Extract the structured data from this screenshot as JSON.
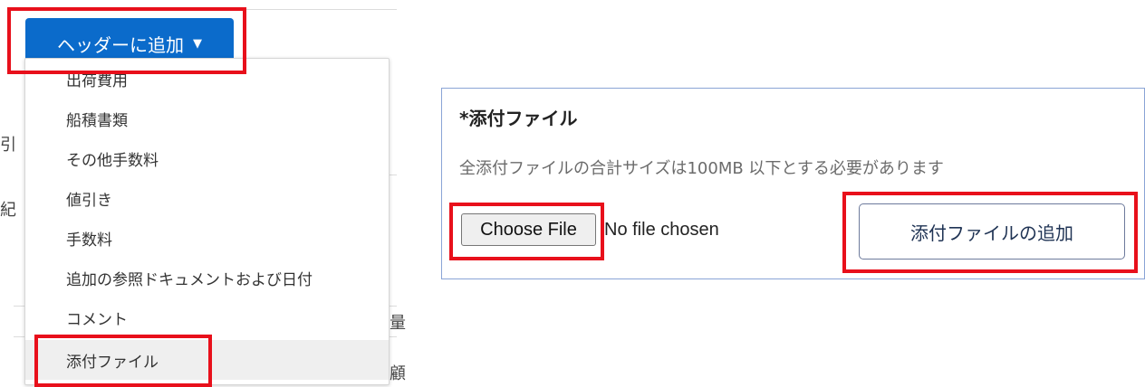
{
  "header_add": {
    "label": "ヘッダーに追加",
    "caret": "▼"
  },
  "dropdown": {
    "items": [
      {
        "label": "出荷費用"
      },
      {
        "label": "船積書類"
      },
      {
        "label": "その他手数料"
      },
      {
        "label": "値引き"
      },
      {
        "label": "手数料"
      },
      {
        "label": "追加の参照ドキュメントおよび日付"
      },
      {
        "label": "コメント"
      },
      {
        "label": "添付ファイル"
      }
    ],
    "active_index": 7
  },
  "background": {
    "fragments": [
      "引",
      "紀",
      "量",
      "顧"
    ]
  },
  "attachment": {
    "title": "*添付ファイル",
    "description": "全添付ファイルの合計サイズは100MB 以下とする必要があります",
    "choose_file_label": "Choose File",
    "no_file_text": "No file chosen",
    "add_button_label": "添付ファイルの追加"
  },
  "colors": {
    "primary": "#0b6bcb",
    "highlight": "#e8101b",
    "panel_border": "#8aa4d6"
  }
}
